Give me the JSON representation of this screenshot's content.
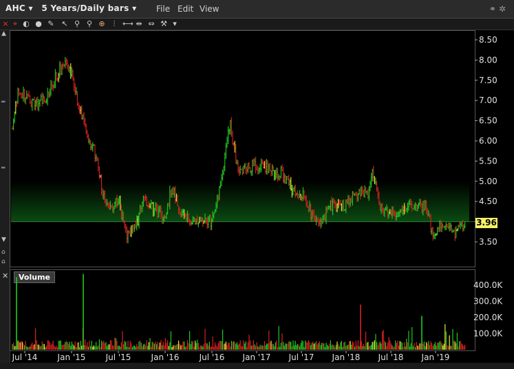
{
  "title_bar": {
    "symbol": "AHC",
    "timeframe": "5 Years/Daily bars",
    "menu": [
      "File",
      "Edit",
      "View"
    ]
  },
  "price_chart": {
    "price_axis_ticks": [
      "8.50",
      "8.00",
      "7.50",
      "7.00",
      "6.50",
      "6.00",
      "5.50",
      "5.00",
      "4.50",
      "4.00",
      "3.50"
    ],
    "last_price": "3.96",
    "colors": {
      "up": "#22cc22",
      "down": "#dd2222",
      "neutral": "#eeee33",
      "highlight_band": "#0b4a12"
    }
  },
  "volume_panel": {
    "label": "Volume",
    "axis_ticks": [
      "400.0K",
      "300.0K",
      "200.0K",
      "100.0K"
    ]
  },
  "time_axis": {
    "ticks": [
      "Jul '14",
      "Jan '15",
      "Jul '15",
      "Jan '16",
      "Jul '16",
      "Jan '17",
      "Jul '17",
      "Jan '18",
      "Jul '18",
      "Jan '19"
    ]
  },
  "chart_data": {
    "type": "line",
    "title": "AHC 5 Years/Daily bars",
    "x": [
      "Jul '14",
      "Jan '15",
      "Jul '15",
      "Jan '16",
      "Jul '16",
      "Jan '17",
      "Jul '17",
      "Jan '18",
      "Jul '18",
      "Jan '19"
    ],
    "series": [
      {
        "name": "AHC",
        "values": [
          7.1,
          7.7,
          4.6,
          4.4,
          4.0,
          5.3,
          4.9,
          4.4,
          4.2,
          3.9
        ]
      }
    ],
    "ylim": [
      3.2,
      8.6
    ],
    "last_price": 3.96,
    "volume": {
      "axis_ticks": [
        100000,
        200000,
        300000,
        400000
      ],
      "peaks": [
        {
          "x": "Jul '14",
          "value": 450000
        },
        {
          "x": "Jan '15",
          "value": 470000
        },
        {
          "x": "Jan '18",
          "value": 280000
        },
        {
          "x": "Jan '19",
          "value": 210000
        }
      ]
    }
  }
}
